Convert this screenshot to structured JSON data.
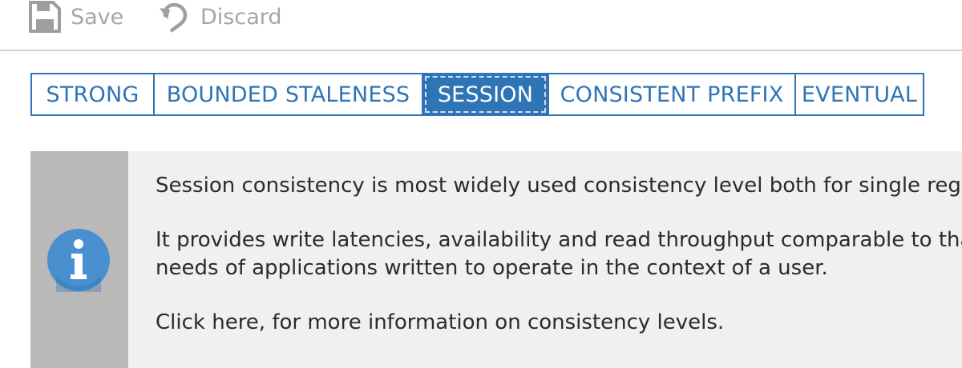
{
  "toolbar": {
    "save_label": "Save",
    "discard_label": "Discard",
    "save_icon": "floppy-disk-icon",
    "discard_icon": "undo-icon"
  },
  "consistency_levels": {
    "selected": "SESSION",
    "items": [
      {
        "label": "STRONG"
      },
      {
        "label": "BOUNDED STALENESS"
      },
      {
        "label": "SESSION"
      },
      {
        "label": "CONSISTENT PREFIX"
      },
      {
        "label": "EVENTUAL"
      }
    ]
  },
  "info": {
    "icon": "info-icon",
    "paragraph1": "Session consistency is most widely used consistency level both for single regio",
    "paragraph2_line1": "It provides write latencies, availability and read throughput comparable to tha",
    "paragraph2_line2": "needs of applications written to operate in the context of a user.",
    "link_text": "Click here, for more information on consistency levels."
  },
  "colors": {
    "accent": "#2f74b5",
    "toolbar_text": "#a6a6a6",
    "info_background": "#f0f0f0",
    "info_stripe": "#b9b9b9",
    "info_icon": "#4a90d0"
  }
}
